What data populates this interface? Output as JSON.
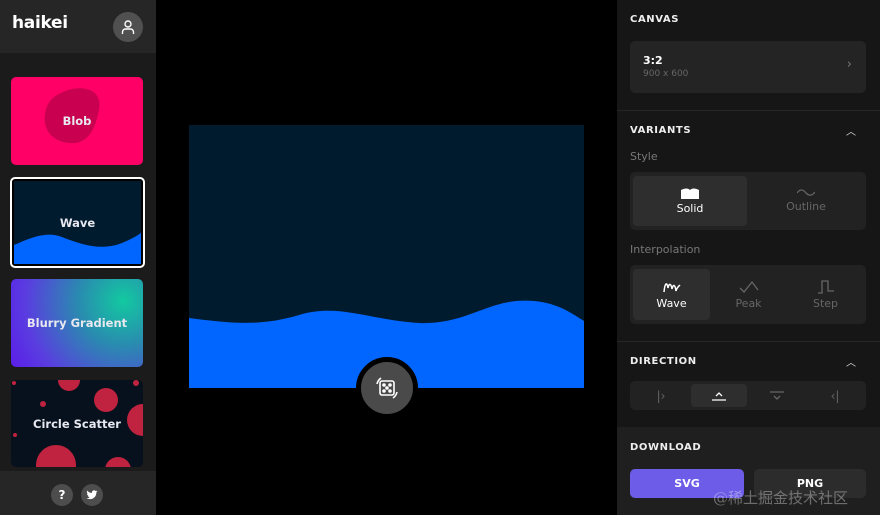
{
  "sidebar": {
    "logo": "haikei",
    "cards": [
      {
        "label": "Blob"
      },
      {
        "label": "Wave"
      },
      {
        "label": "Blurry Gradient"
      },
      {
        "label": "Circle Scatter"
      }
    ],
    "help": "?"
  },
  "canvas": {
    "background": "#001b2e",
    "wave_color": "#0066ff"
  },
  "panel": {
    "canvas_title": "CANVAS",
    "ratio": "3:2",
    "size": "900 x 600",
    "variants_title": "VARIANTS",
    "style_label": "Style",
    "style_options": [
      "Solid",
      "Outline"
    ],
    "style_selected": "Solid",
    "interp_label": "Interpolation",
    "interp_options": [
      "Wave",
      "Peak",
      "Step"
    ],
    "interp_selected": "Wave",
    "direction_title": "DIRECTION",
    "download_title": "DOWNLOAD",
    "svg": "SVG",
    "png": "PNG"
  },
  "watermark": "@稀土掘金技术社区",
  "colors": {
    "accent": "#6c5ce7"
  }
}
